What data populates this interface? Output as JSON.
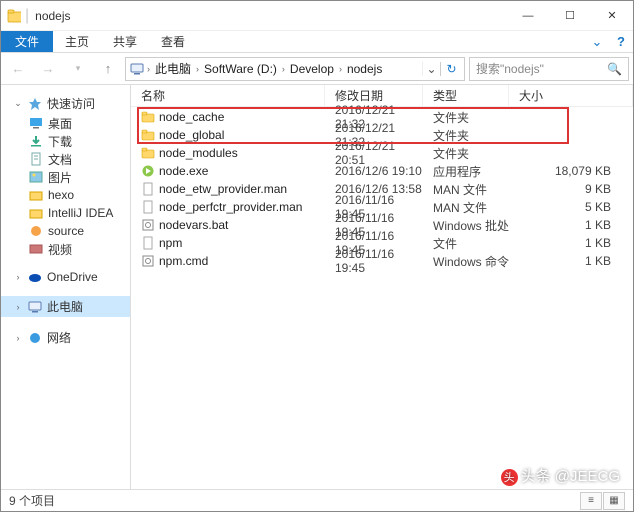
{
  "window": {
    "title": "nodejs"
  },
  "menubar": {
    "file": "文件",
    "home": "主页",
    "share": "共享",
    "view": "查看"
  },
  "breadcrumb": {
    "root_icon": "pc-icon",
    "items": [
      "此电脑",
      "SoftWare (D:)",
      "Develop",
      "nodejs"
    ],
    "refresh": "↻",
    "dropdown": "⌄"
  },
  "search": {
    "placeholder": "搜索\"nodejs\""
  },
  "sidebar": {
    "quick": {
      "label": "快速访问",
      "items": [
        {
          "icon": "desktop",
          "label": "桌面"
        },
        {
          "icon": "download",
          "label": "下载"
        },
        {
          "icon": "doc",
          "label": "文档"
        },
        {
          "icon": "picture",
          "label": "图片"
        },
        {
          "icon": "hexo",
          "label": "hexo"
        },
        {
          "icon": "idea",
          "label": "IntelliJ IDEA"
        },
        {
          "icon": "source",
          "label": "source"
        },
        {
          "icon": "video",
          "label": "视频"
        }
      ]
    },
    "onedrive": {
      "label": "OneDrive"
    },
    "thispc": {
      "label": "此电脑"
    },
    "network": {
      "label": "网络"
    }
  },
  "columns": {
    "name": "名称",
    "date": "修改日期",
    "type": "类型",
    "size": "大小"
  },
  "files": [
    {
      "icon": "folder",
      "name": "node_cache",
      "date": "2016/12/21 21:32",
      "type": "文件夹",
      "size": "",
      "hl": true
    },
    {
      "icon": "folder",
      "name": "node_global",
      "date": "2016/12/21 21:32",
      "type": "文件夹",
      "size": "",
      "hl": true
    },
    {
      "icon": "folder",
      "name": "node_modules",
      "date": "2016/12/21 20:51",
      "type": "文件夹",
      "size": ""
    },
    {
      "icon": "exe",
      "name": "node.exe",
      "date": "2016/12/6 19:10",
      "type": "应用程序",
      "size": "18,079 KB"
    },
    {
      "icon": "man",
      "name": "node_etw_provider.man",
      "date": "2016/12/6 13:58",
      "type": "MAN 文件",
      "size": "9 KB"
    },
    {
      "icon": "man",
      "name": "node_perfctr_provider.man",
      "date": "2016/11/16 19:45",
      "type": "MAN 文件",
      "size": "5 KB"
    },
    {
      "icon": "bat",
      "name": "nodevars.bat",
      "date": "2016/11/16 19:45",
      "type": "Windows 批处理...",
      "size": "1 KB"
    },
    {
      "icon": "file",
      "name": "npm",
      "date": "2016/11/16 19:45",
      "type": "文件",
      "size": "1 KB"
    },
    {
      "icon": "cmd",
      "name": "npm.cmd",
      "date": "2016/11/16 19:45",
      "type": "Windows 命令脚本",
      "size": "1 KB"
    }
  ],
  "status": {
    "count": "9 个项目"
  },
  "watermark": {
    "text": "头条 @JEECG"
  }
}
